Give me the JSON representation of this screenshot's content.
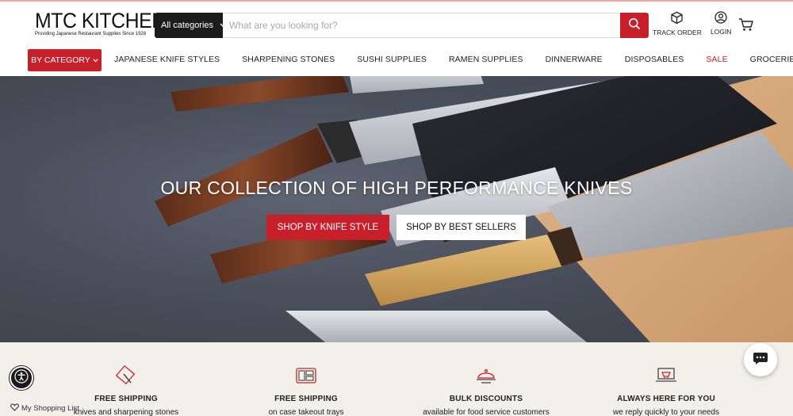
{
  "header": {
    "logo_title": "MTC KITCHEN",
    "logo_tagline": "Providing Japanese Restaurant Supplies Since 1928",
    "search": {
      "category_label": "All categories",
      "placeholder": "What are you looking for?"
    },
    "track_order_label": "TRACK ORDER",
    "login_label": "LOGIN"
  },
  "nav": {
    "category_button": "BY CATEGORY",
    "items": [
      {
        "label": "JAPANESE KNIFE STYLES"
      },
      {
        "label": "SHARPENING STONES"
      },
      {
        "label": "SUSHI SUPPLIES"
      },
      {
        "label": "RAMEN SUPPLIES"
      },
      {
        "label": "DINNERWARE"
      },
      {
        "label": "DISPOSABLES"
      },
      {
        "label": "SALE"
      },
      {
        "label": "GROCERIES"
      }
    ]
  },
  "hero": {
    "title": "OUR COLLECTION OF HIGH PERFORMANCE KNIVES",
    "primary_button": "SHOP BY KNIFE STYLE",
    "secondary_button": "SHOP BY BEST SELLERS"
  },
  "features": [
    {
      "title": "FREE SHIPPING",
      "subtitle": "knives and sharpening stones",
      "icon": "knife-box-icon"
    },
    {
      "title": "FREE SHIPPING",
      "subtitle": "on case takeout trays",
      "icon": "takeout-tray-icon"
    },
    {
      "title": "BULK DISCOUNTS",
      "subtitle": "available for food service customers",
      "icon": "cloche-icon"
    },
    {
      "title": "ALWAYS HERE FOR YOU",
      "subtitle": "we reply quickly to your needs",
      "icon": "support-laptop-icon"
    }
  ],
  "shopping_list_label": "My Shopping List",
  "colors": {
    "accent_red": "#c8202a",
    "search_category_bg": "#1c1c1c",
    "features_bg": "#f3efe9"
  }
}
